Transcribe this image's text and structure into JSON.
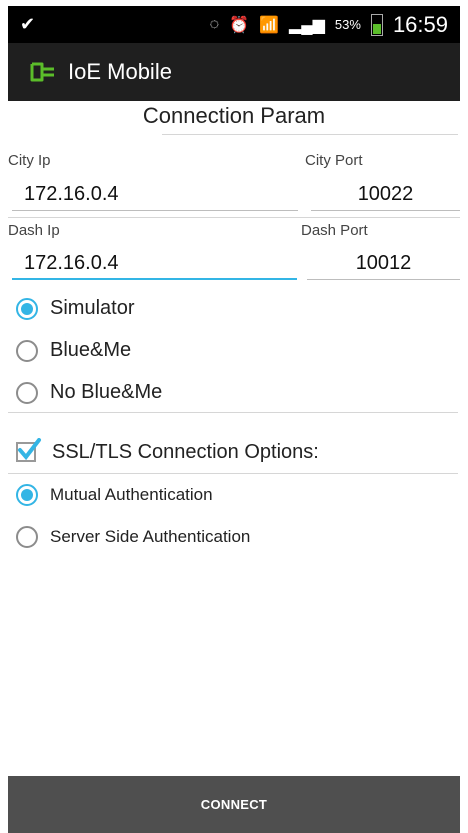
{
  "status": {
    "battery": "53%",
    "time": "16:59"
  },
  "app": {
    "title": "IoE Mobile"
  },
  "section": {
    "title": "Connection Param"
  },
  "city": {
    "ip_label": "City Ip",
    "ip_value": "172.16.0.4",
    "port_label": "City Port",
    "port_value": "10022"
  },
  "dash": {
    "ip_label": "Dash Ip",
    "ip_value": "172.16.0.4",
    "port_label": "Dash Port",
    "port_value": "10012"
  },
  "modes": [
    {
      "label": "Simulator",
      "checked": true
    },
    {
      "label": "Blue&Me",
      "checked": false
    },
    {
      "label": "No Blue&Me",
      "checked": false
    }
  ],
  "ssl": {
    "label": "SSL/TLS Connection Options:",
    "checked": true
  },
  "auth": [
    {
      "label": "Mutual Authentication",
      "checked": true
    },
    {
      "label": "Server Side Authentication",
      "checked": false
    }
  ],
  "connect_label": "CONNECT",
  "colors": {
    "accent": "#33b5e5",
    "app_icon": "#5bbd2a",
    "action_bar": "#1f1f1f",
    "connect_bar": "#4f4f4f"
  }
}
